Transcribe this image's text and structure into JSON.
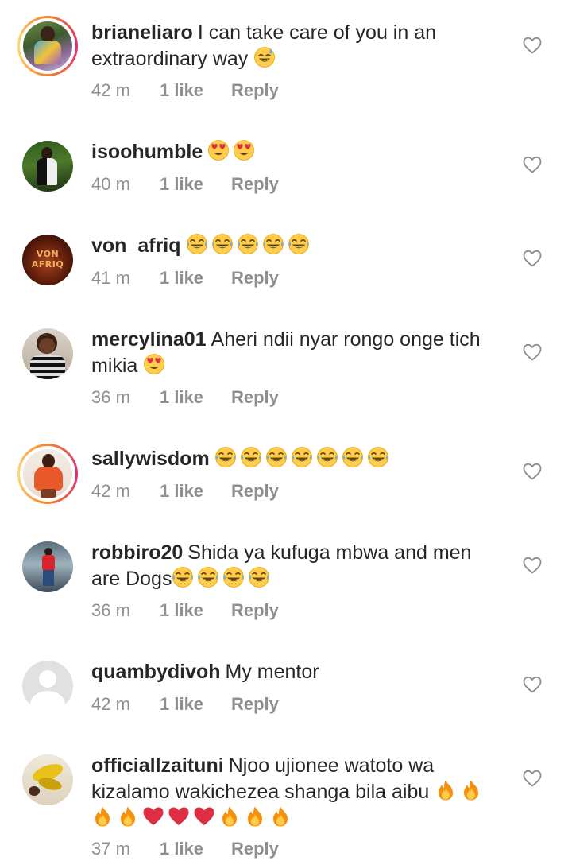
{
  "comments": [
    {
      "username": "brianeliaro",
      "text": "I can take care of you in an extraordinary way",
      "emojis": [
        "grinning-sweat"
      ],
      "time": "42 m",
      "likes": "1 like",
      "reply": "Reply",
      "story_ring": true
    },
    {
      "username": "isoohumble",
      "text": "",
      "emojis": [
        "heart-eyes",
        "heart-eyes"
      ],
      "time": "40 m",
      "likes": "1 like",
      "reply": "Reply",
      "story_ring": false
    },
    {
      "username": "von_afriq",
      "text": "",
      "emojis": [
        "tears-of-joy",
        "tears-of-joy",
        "tears-of-joy",
        "tears-of-joy",
        "tears-of-joy"
      ],
      "time": "41 m",
      "likes": "1 like",
      "reply": "Reply",
      "story_ring": false,
      "avatar_text": "VON AFRIQ"
    },
    {
      "username": "mercylina01",
      "text": "Aheri ndii nyar rongo onge tich mikia",
      "emojis": [
        "heart-eyes"
      ],
      "time": "36 m",
      "likes": "1 like",
      "reply": "Reply",
      "story_ring": false
    },
    {
      "username": "sallywisdom",
      "text": "",
      "emojis": [
        "tears-of-joy",
        "tears-of-joy",
        "tears-of-joy",
        "tears-of-joy",
        "tears-of-joy",
        "tears-of-joy",
        "tears-of-joy"
      ],
      "time": "42 m",
      "likes": "1 like",
      "reply": "Reply",
      "story_ring": true
    },
    {
      "username": "robbiro20",
      "text": "Shida ya kufuga mbwa and men are Dogs",
      "emojis": [
        "tears-of-joy",
        "tears-of-joy",
        "tears-of-joy",
        "tears-of-joy"
      ],
      "time": "36 m",
      "likes": "1 like",
      "reply": "Reply",
      "story_ring": false
    },
    {
      "username": "quambydivoh",
      "text": "My mentor",
      "emojis": [],
      "time": "42 m",
      "likes": "1 like",
      "reply": "Reply",
      "story_ring": false
    },
    {
      "username": "officiallzaituni",
      "text": "Njoo ujionee watoto wa kizalamo wakichezea  shanga bila aibu",
      "emojis": [
        "fire",
        "fire",
        "fire",
        "fire",
        "red-heart",
        "red-heart",
        "red-heart",
        "fire",
        "fire",
        "fire"
      ],
      "time": "37 m",
      "likes": "1 like",
      "reply": "Reply",
      "story_ring": false
    }
  ],
  "icons": {
    "like": "heart-outline-icon",
    "default_avatar": "default-avatar-icon"
  },
  "colors": {
    "text": "#262626",
    "meta": "#8e8e8e",
    "story_ring_start": "#f58529",
    "story_ring_end": "#dd2a7b"
  }
}
